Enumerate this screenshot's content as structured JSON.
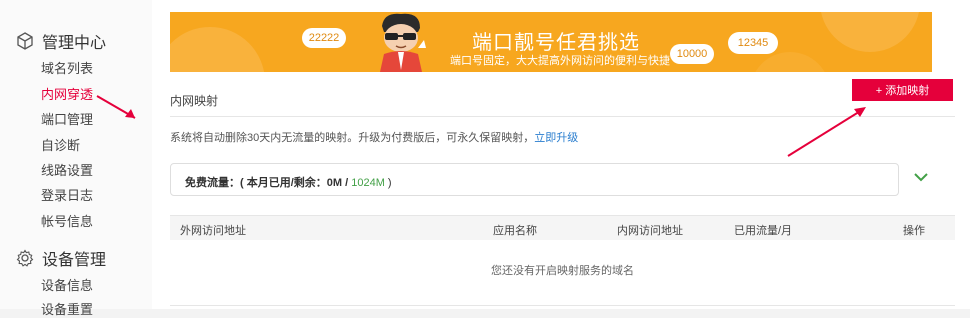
{
  "sidebar": {
    "section1": {
      "title": "管理中心",
      "icon": "cube-icon"
    },
    "items1": [
      "域名列表",
      "内网穿透",
      "端口管理",
      "自诊断",
      "线路设置",
      "登录日志",
      "帐号信息"
    ],
    "section2": {
      "title": "设备管理",
      "icon": "gear-icon"
    },
    "items2": [
      "设备信息",
      "设备重置"
    ],
    "active_color": "#e5003b"
  },
  "banner": {
    "title": "端口靓号任君挑选",
    "subtitle": "端口号固定，大大提高外网访问的便利与快捷",
    "clouds": [
      "22222",
      "10000",
      "12345"
    ],
    "color": "#f7a71f"
  },
  "header": {
    "title": "内网映射",
    "add_button": "+ 添加映射"
  },
  "notice": {
    "text": "系统将自动删除30天内无流量的映射。升级为付费版后，可永久保留映射，",
    "link": "立即升级"
  },
  "traffic": {
    "label": "免费流量：( 本月已用/剩余：0M / ",
    "total": "1024M",
    "suffix": " )"
  },
  "table": {
    "columns": [
      "外网访问地址",
      "应用名称",
      "内网访问地址",
      "已用流量/月",
      "操作"
    ],
    "empty_text": "您还没有开启映射服务的域名"
  }
}
